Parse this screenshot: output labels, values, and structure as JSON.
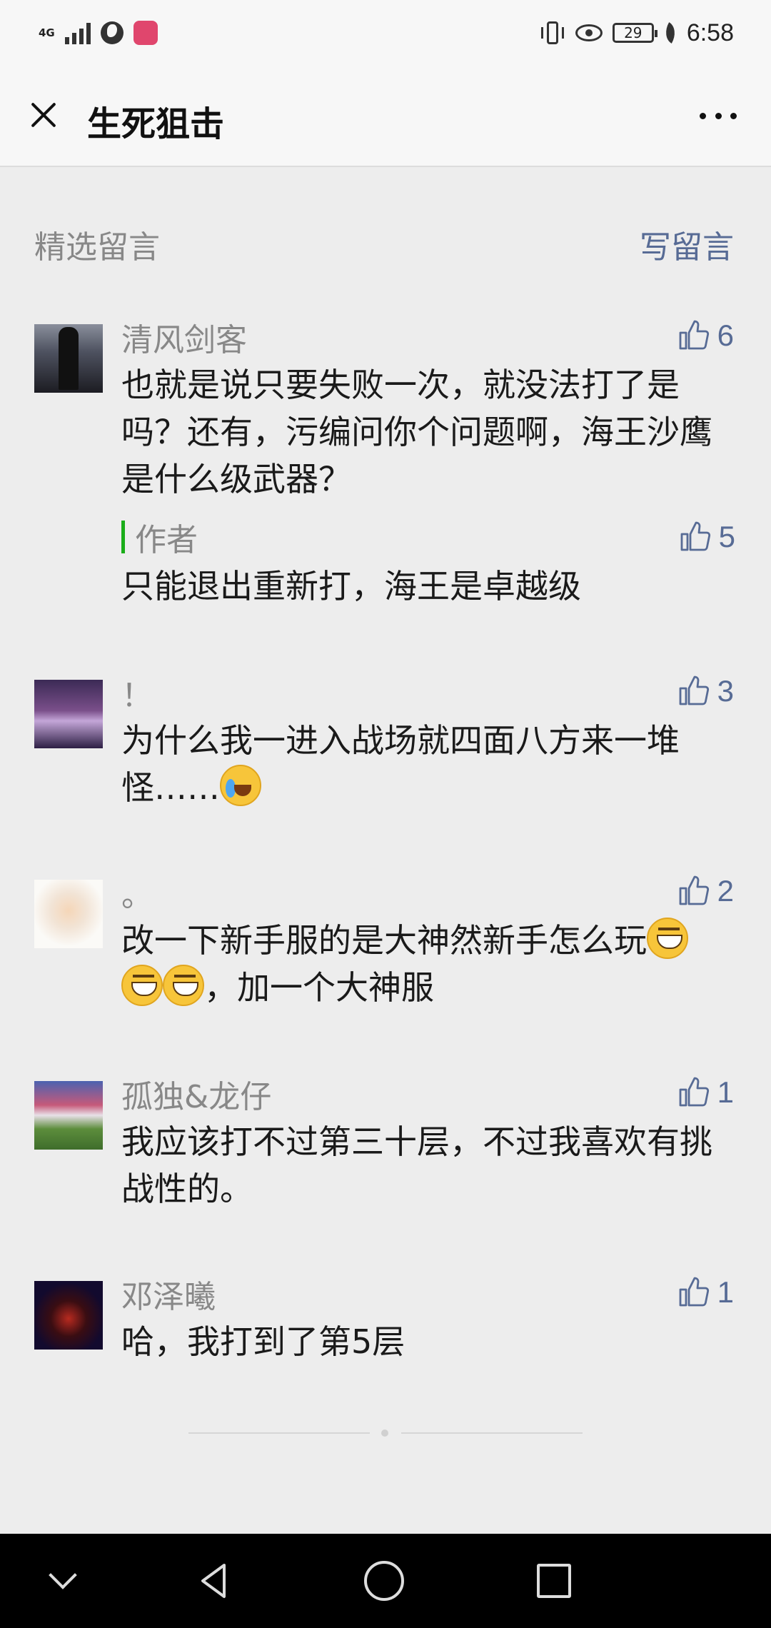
{
  "status_bar": {
    "network": "4G",
    "battery": "29",
    "time": "6:58"
  },
  "header": {
    "title": "生死狙击"
  },
  "section": {
    "label": "精选留言",
    "write_comment": "写留言"
  },
  "comments": [
    {
      "name": "清风剑客",
      "likes": "6",
      "text": "也就是说只要失败一次，就没法打了是吗？还有，污编问你个问题啊，海王沙鹰是什么级武器？",
      "reply": {
        "author": "作者",
        "likes": "5",
        "text": "只能退出重新打，海王是卓越级"
      }
    },
    {
      "name": "！",
      "likes": "3",
      "text_before": "为什么我一进入战场就四面八方来一堆怪……",
      "emoji_1": "cry-laugh-emoji"
    },
    {
      "name": "。",
      "likes": "2",
      "text_before": "改一下新手服的是大神然新手怎么玩",
      "text_after": "，加一个大神服",
      "emoji_1": "grin-emoji"
    },
    {
      "name": "孤独&龙仔",
      "likes": "1",
      "text": "我应该打不过第三十层，不过我喜欢有挑战性的。"
    },
    {
      "name": "邓泽曦",
      "likes": "1",
      "text": "哈，我打到了第5层"
    }
  ],
  "colors": {
    "link": "#576b95",
    "author_bar": "#1aad19",
    "background": "#ededed"
  }
}
